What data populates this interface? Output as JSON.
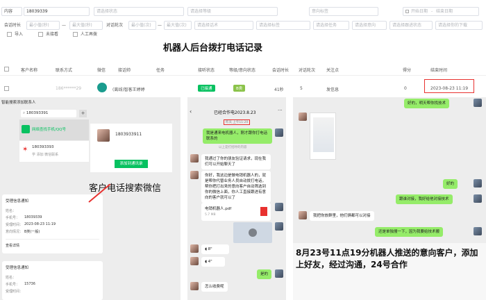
{
  "filters": {
    "row1": {
      "content_label": "内容",
      "phone_value": "18039339",
      "f2": "请选择状态",
      "f3": "请选择等级",
      "f4": "意向标签",
      "f5_icon": "calendar-icon",
      "date_start": "开始日期",
      "date_sep": "-",
      "date_end": "结束日期"
    },
    "row2": {
      "duration_label": "会话时长",
      "min_sec": "最小值(秒)",
      "dash": "—",
      "max_sec": "最大值(秒)",
      "rounds_label": "对话轮次",
      "min_val": "最小值(次)",
      "max_val": "最大值(次)",
      "f6": "请选择话术",
      "f7": "请选择标签",
      "f8": "请选择任务",
      "f9": "请选择意向",
      "f10": "请选择跟进状态",
      "f11": "请选择你的下载"
    },
    "row3": {
      "c1": "导入",
      "c2": "未接看",
      "c3": "人工再拨"
    }
  },
  "headline": "机器人后台拨打电话记录",
  "table": {
    "headers": [
      "客户名称",
      "联系方式",
      "微信",
      "接话帅",
      "任务",
      "接听状态",
      "等级/意向状态",
      "会话时长",
      "对话轮次",
      "关注点",
      "得分",
      "结束时间"
    ],
    "row": {
      "contact": "186******29",
      "speaker": "(离线)智客王婷婷",
      "status": "已接通",
      "level": "B类",
      "duration": "41秒",
      "rounds": "5",
      "focus": "发信息",
      "score": "0",
      "end_time": "2023-08-23 11:19"
    }
  },
  "left_panel": {
    "title": "智能搜索添加联系人",
    "search_value": "180393391",
    "result1": "网络查找手机/QQ号",
    "result2": "180393393",
    "result2_sub": "学 添加 微信联系",
    "card_name": "1803933911",
    "card_button": "添加到通讯录",
    "caption": "客户电话搜索微信",
    "notice_title": "受理信息通知",
    "n_name_k": "姓名：",
    "n_phone_k": "手机号：",
    "n_phone_v": "18039339",
    "n_time_k": "受理时间：",
    "n_time_v": "2023-08-23 11:19",
    "n_intent_k": "意向情况：",
    "n_intent_v": "B类(一般)",
    "n_detail": "查看详情",
    "notice2_title": "受理信息通知",
    "n2_name_k": "姓名：",
    "n2_phone_k": "手机号：",
    "n2_phone_v": "15736",
    "n2_time_k": "受理时间："
  },
  "chat1": {
    "title": "已经合作电2023.8.23",
    "time_tag": "昨天 上午11:20",
    "msg1": "我是通来电机器人，刚才跟你打电话联系的",
    "sys": "以上是打招呼的内容",
    "msg2": "我通过了你的朋友验证请求，现在我们可以开始聊天了",
    "msg3": "你好，我这边是做电销机器人的，就是帮你代替业务人员自动拨打电话，帮你把打出来的意向客户自动筛选到你的微信上面，你人工直接跟进有意向的客户就可以了",
    "file_name": "电销机器人.pdf",
    "file_size": "5.7 MB",
    "v1": "8\"",
    "v2": "4\"",
    "ok": "是的",
    "last": "怎么收费呢"
  },
  "chat2": {
    "top": "好的，明天帮你找技术",
    "ok": "好的",
    "msg_a": "跟谁对接，我好给他对接技术",
    "msg_b": "我把你放群里，他们俩都可以对接",
    "msg_c": "还是单独搜一下，因为我要给技术搬",
    "caption": "8月23号11点19分机器人推送的意向客户，添加上好友，经过沟通，24号合作"
  },
  "colors": {
    "green": "#07c160",
    "highlight": "#e8312f",
    "chat_bg": "#ededed",
    "bubble": "#95ec69"
  }
}
